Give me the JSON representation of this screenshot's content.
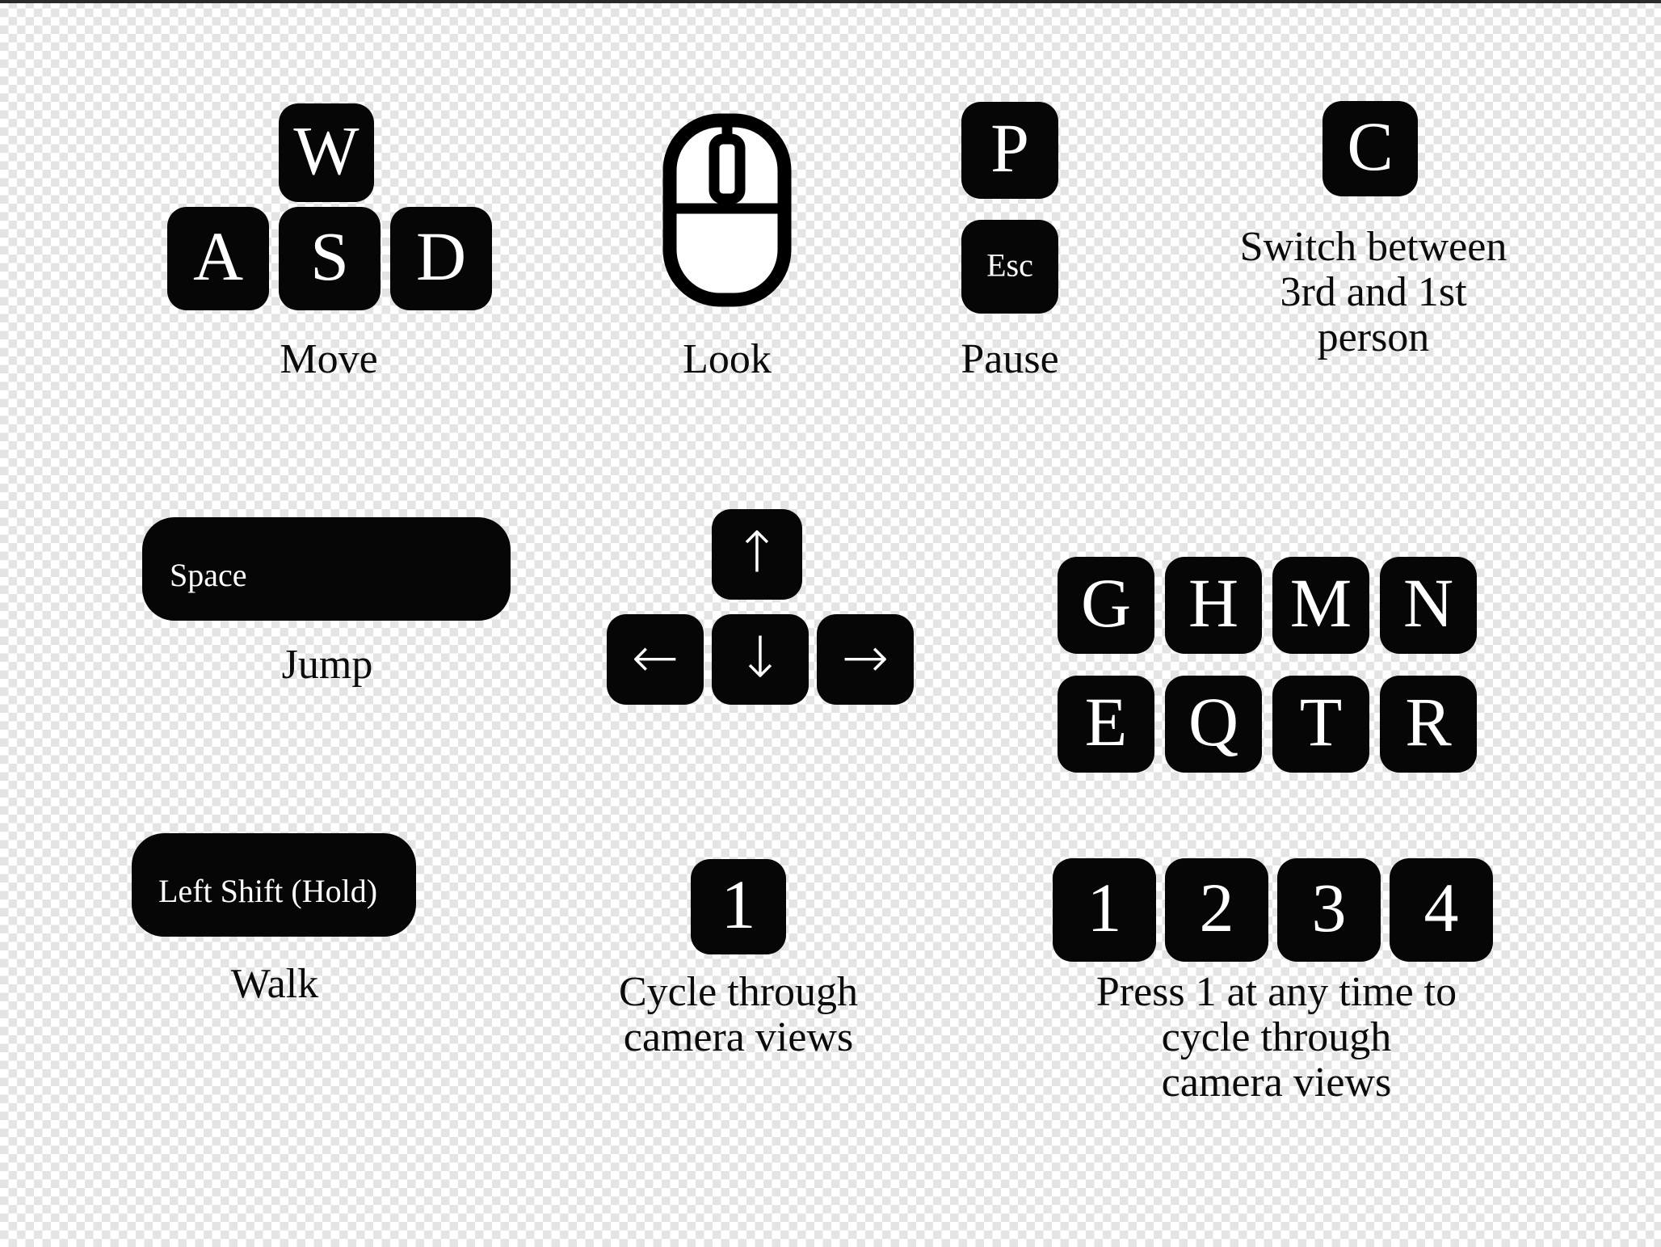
{
  "page": {
    "title": "Game Controls Legend",
    "background": "transparent-checkerboard",
    "key_color": "#060606",
    "key_text_color": "#ffffff",
    "caption_color": "#0b0b0b"
  },
  "groups": [
    {
      "id": "move",
      "keys": [
        "W",
        "A",
        "S",
        "D"
      ],
      "caption": "Move"
    },
    {
      "id": "look",
      "icon": "mouse-icon",
      "caption": "Look"
    },
    {
      "id": "pause",
      "keys": [
        "P",
        "Esc"
      ],
      "caption": "Pause"
    },
    {
      "id": "camera-person",
      "keys": [
        "C"
      ],
      "caption_lines": [
        "Switch between",
        "3rd and 1st",
        "person"
      ],
      "caption": "Switch between 3rd and 1st person"
    },
    {
      "id": "jump",
      "keys": [
        "Space"
      ],
      "caption": "Jump"
    },
    {
      "id": "arrows",
      "keys": [
        "↑",
        "←",
        "↓",
        "→"
      ],
      "caption": ""
    },
    {
      "id": "letter-bank",
      "row1": [
        "G",
        "H",
        "M",
        "N"
      ],
      "row2": [
        "E",
        "Q",
        "T",
        "R"
      ],
      "caption": ""
    },
    {
      "id": "walk",
      "keys": [
        "Left Shift (Hold)"
      ],
      "caption": "Walk"
    },
    {
      "id": "cycle-camera",
      "keys": [
        "1"
      ],
      "caption_lines": [
        "Cycle through",
        "camera views"
      ],
      "caption": "Cycle through camera views"
    },
    {
      "id": "number-bank",
      "keys": [
        "1",
        "2",
        "3",
        "4"
      ],
      "caption_lines": [
        "Press 1 at any time to",
        "cycle through",
        "camera views"
      ],
      "caption": "Press 1 at any time to cycle through camera views"
    }
  ],
  "labels": {
    "w": "W",
    "a": "A",
    "s": "S",
    "d": "D",
    "move": "Move",
    "look": "Look",
    "p": "P",
    "esc": "Esc",
    "pause": "Pause",
    "c": "C",
    "switch_l1": "Switch between",
    "switch_l2": "3rd and 1st",
    "switch_l3": "person",
    "space": "Space",
    "jump": "Jump",
    "arrow_up": "↑",
    "arrow_left": "←",
    "arrow_down": "↓",
    "arrow_right": "→",
    "g": "G",
    "h": "H",
    "m": "M",
    "n": "N",
    "e": "E",
    "q": "Q",
    "t": "T",
    "r": "R",
    "left_shift": "Left Shift (Hold)",
    "walk": "Walk",
    "one": "1",
    "cycle_l1": "Cycle through",
    "cycle_l2": "camera views",
    "num1": "1",
    "num2": "2",
    "num3": "3",
    "num4": "4",
    "press_l1": "Press 1 at any time to",
    "press_l2": "cycle through",
    "press_l3": "camera views"
  }
}
